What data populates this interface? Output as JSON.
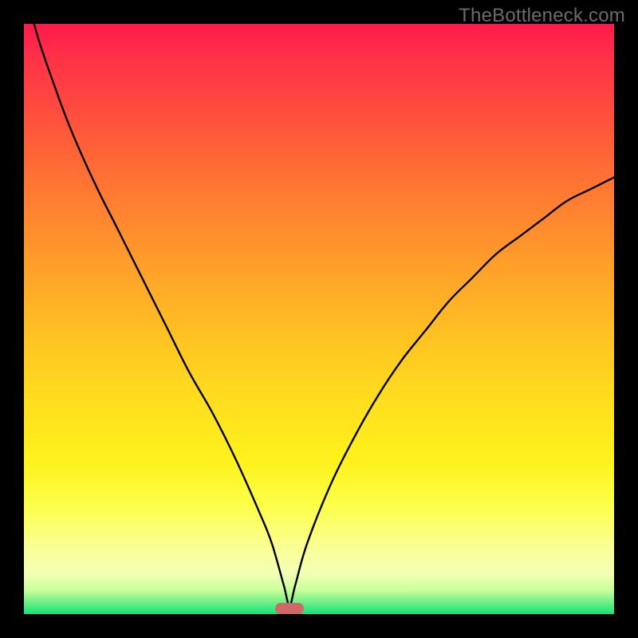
{
  "watermark": "TheBottleneck.com",
  "colors": {
    "frame_bg": "#000000",
    "curve": "#000000",
    "marker": "#d06868",
    "gradient_top": "#ff1a4b",
    "gradient_mid": "#ffde1e",
    "gradient_bottom": "#14e27a"
  },
  "chart_data": {
    "type": "line",
    "title": "",
    "xlabel": "",
    "ylabel": "",
    "xlim": [
      0,
      100
    ],
    "ylim": [
      0,
      100
    ],
    "grid": false,
    "legend": false,
    "minimum_x": 45,
    "marker": {
      "x": 45,
      "shape": "rounded-bar"
    },
    "series": [
      {
        "name": "curve",
        "x": [
          0,
          2,
          5,
          8,
          12,
          16,
          20,
          24,
          28,
          32,
          36,
          40,
          42,
          44,
          45,
          46,
          48,
          52,
          56,
          60,
          64,
          68,
          72,
          76,
          80,
          84,
          88,
          92,
          96,
          100
        ],
        "values": [
          108,
          99,
          90,
          82,
          73,
          65,
          57,
          49,
          41,
          34,
          26,
          17,
          12,
          5,
          1.5,
          5,
          12,
          22,
          30,
          37,
          43,
          48,
          53,
          57,
          61,
          64,
          67,
          70,
          72,
          74
        ]
      }
    ],
    "note": "Values estimated from image pixels; y expressed as percent of plot height (0 = bottom). Curve descends sharply from top-left, reaches minimum near x≈45, then rises less steeply toward top-right (~74%)."
  }
}
